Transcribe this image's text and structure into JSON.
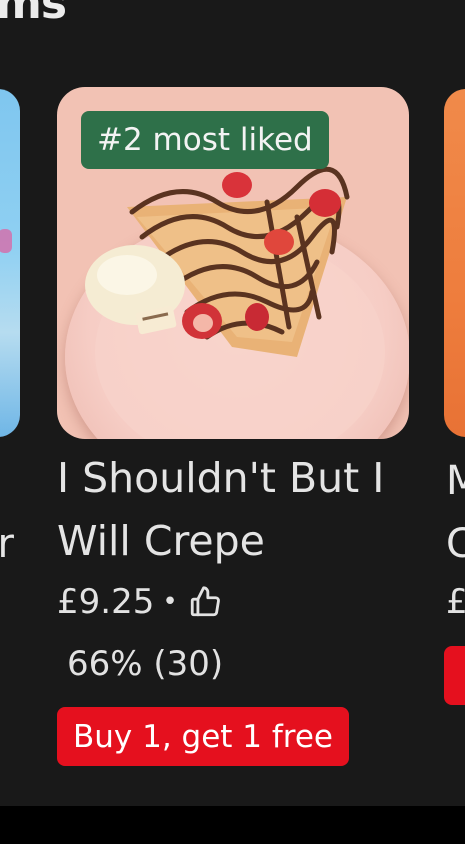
{
  "section": {
    "title_fragment": "ms"
  },
  "left_card": {
    "name_fragment": "a\nBr"
  },
  "item": {
    "badge": "#2 most liked",
    "name": "I Shouldn't But I Will Crepe",
    "price": "£9.25",
    "separator": "•",
    "rating": "66% (30)",
    "promo": "Buy 1, get 1 free",
    "image_alt": "Crepe with chocolate drizzle, strawberries and ice cream"
  },
  "right_card": {
    "name_fragment": "M\nC",
    "price_fragment": "£"
  },
  "colors": {
    "background": "#191919",
    "badge": "#2e7049",
    "promo": "#e5101e",
    "text": "#e4e4e4"
  },
  "icons": {
    "rating": "thumbs-up-icon"
  }
}
